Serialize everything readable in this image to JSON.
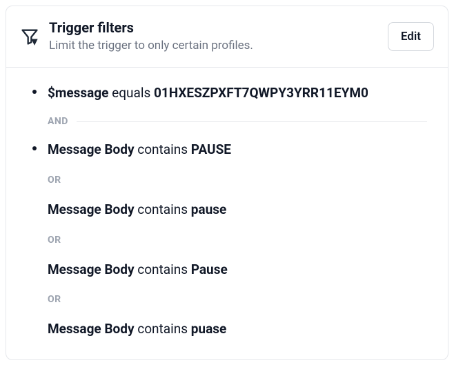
{
  "header": {
    "title": "Trigger filters",
    "subtitle": "Limit the trigger to only certain profiles.",
    "edit_label": "Edit"
  },
  "connectors": {
    "and": "AND",
    "or": "OR"
  },
  "filters": {
    "group1": {
      "field": "$message",
      "op": "equals",
      "value": "01HXESZPXFT7QWPY3YRR11EYM0"
    },
    "group2": {
      "c1": {
        "field": "Message Body",
        "op": "contains",
        "value": "PAUSE"
      },
      "c2": {
        "field": "Message Body",
        "op": "contains",
        "value": "pause"
      },
      "c3": {
        "field": "Message Body",
        "op": "contains",
        "value": "Pause"
      },
      "c4": {
        "field": "Message Body",
        "op": "contains",
        "value": "puase"
      }
    }
  }
}
